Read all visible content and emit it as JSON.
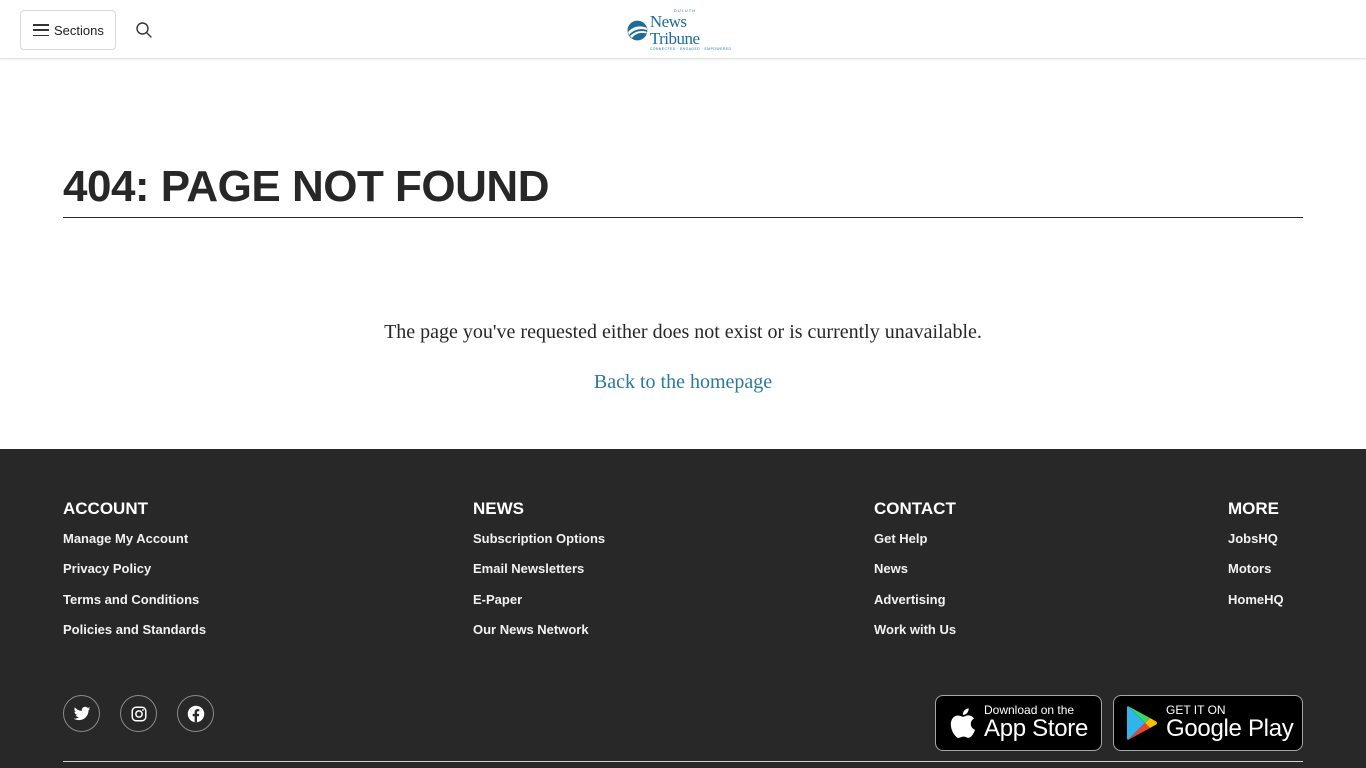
{
  "header": {
    "sections_label": "Sections",
    "logo": {
      "city": "DULUTH",
      "name": "News Tribune",
      "tagline": "CONNECTED · ENGAGED · EMPOWERED"
    },
    "icons": {
      "menu": "hamburger-icon",
      "search": "search-icon"
    }
  },
  "main": {
    "title": "404: PAGE NOT FOUND",
    "message": "The page you've requested either does not exist or is currently unavailable.",
    "home_link": "Back to the homepage"
  },
  "footer": {
    "columns": [
      {
        "heading": "ACCOUNT",
        "links": [
          "Manage My Account",
          "Privacy Policy",
          "Terms and Conditions",
          "Policies and Standards"
        ]
      },
      {
        "heading": "NEWS",
        "links": [
          "Subscription Options",
          "Email Newsletters",
          "E-Paper",
          "Our News Network"
        ]
      },
      {
        "heading": "CONTACT",
        "links": [
          "Get Help",
          "News",
          "Advertising",
          "Work with Us"
        ]
      },
      {
        "heading": "MORE",
        "links": [
          "JobsHQ",
          "Motors",
          "HomeHQ"
        ]
      }
    ],
    "social": [
      "twitter-icon",
      "instagram-icon",
      "facebook-icon"
    ],
    "app_store": {
      "small": "Download on the",
      "big": "App Store"
    },
    "google_play": {
      "small": "GET IT ON",
      "big": "Google Play"
    }
  },
  "colors": {
    "brand_blue": "#1f6c9b",
    "link": "#2a7aa0",
    "footer_bg": "#282828",
    "text": "#272727"
  }
}
